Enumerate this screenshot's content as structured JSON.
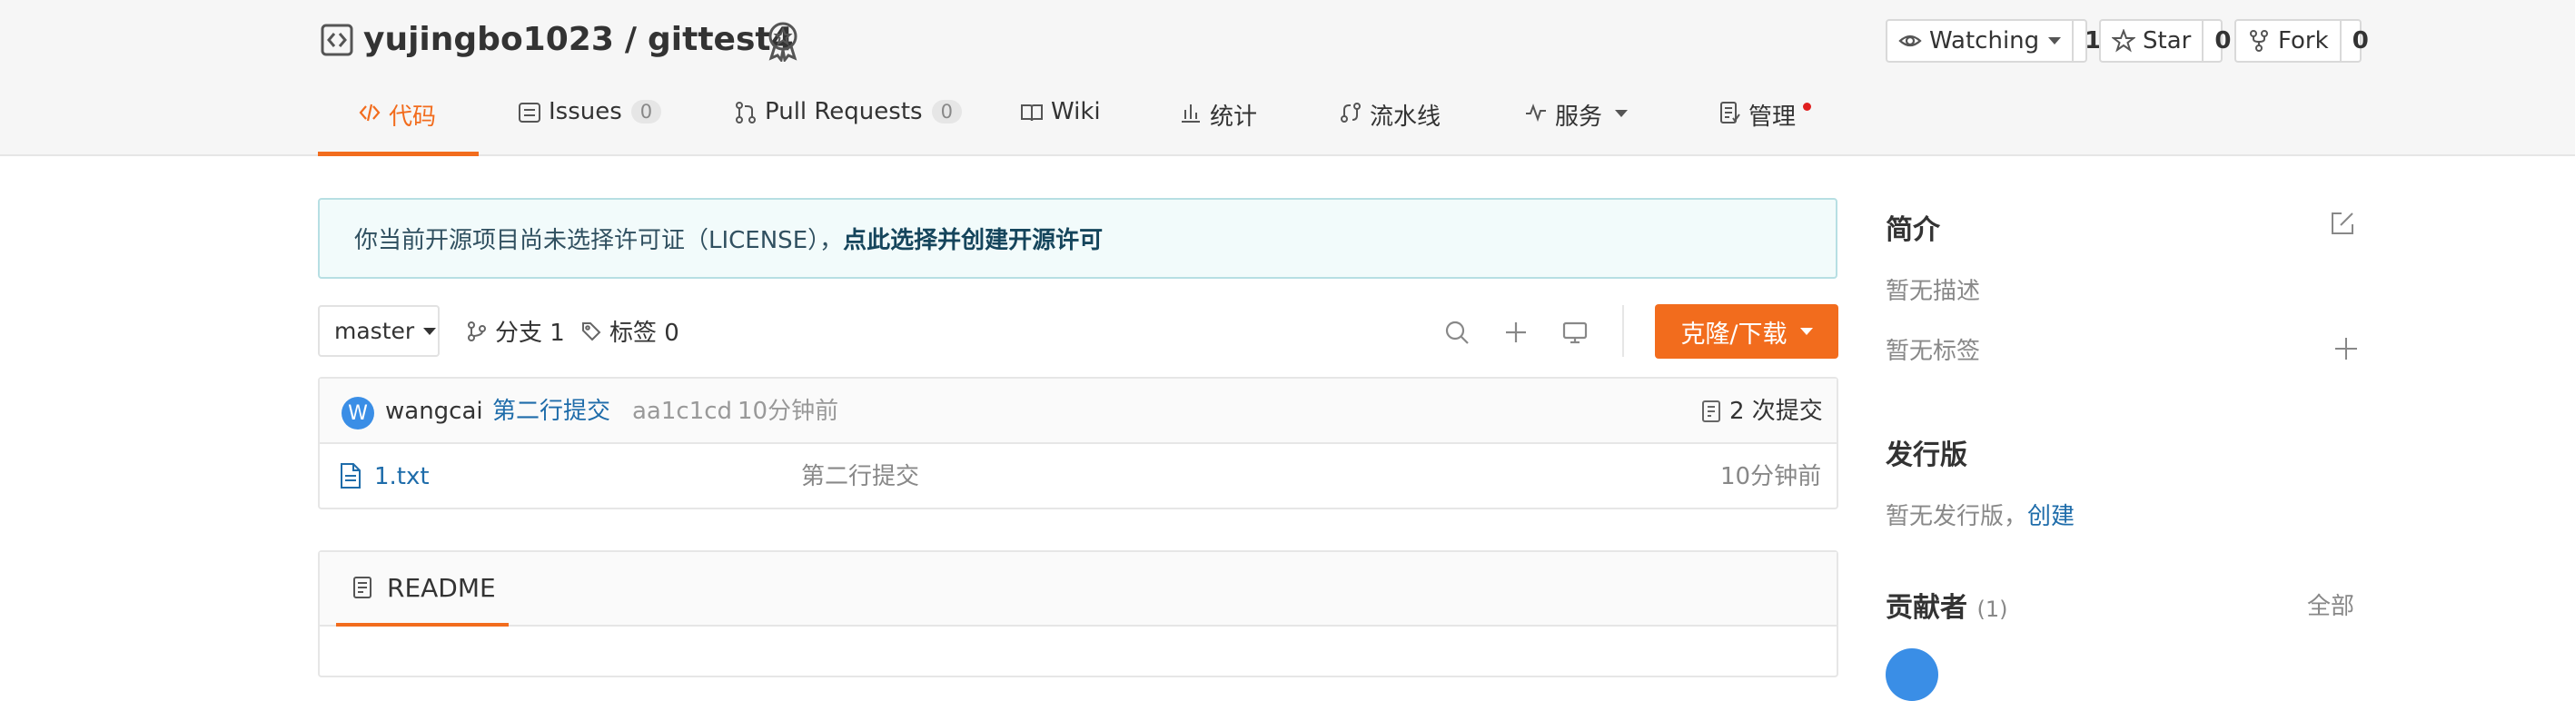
{
  "header": {
    "owner": "yujingbo1023",
    "separator": "/",
    "repo": "gittest4",
    "watch": {
      "label": "Watching",
      "count": "1"
    },
    "star": {
      "label": "Star",
      "count": "0"
    },
    "fork": {
      "label": "Fork",
      "count": "0"
    }
  },
  "tabs": [
    {
      "label": "代码",
      "active": true
    },
    {
      "label": "Issues",
      "badge": "0"
    },
    {
      "label": "Pull Requests",
      "badge": "0"
    },
    {
      "label": "Wiki"
    },
    {
      "label": "统计"
    },
    {
      "label": "流水线"
    },
    {
      "label": "服务"
    },
    {
      "label": "管理"
    }
  ],
  "notice": {
    "text": "你当前开源项目尚未选择许可证（LICENSE），",
    "link": "点此选择并创建开源许可"
  },
  "branch_bar": {
    "branch": "master",
    "branches": "分支 1",
    "tags": "标签 0",
    "clone_label": "克隆/下载"
  },
  "latest_commit": {
    "avatar_letter": "W",
    "author": "wangcai",
    "message": "第二行提交",
    "hash": "aa1c1cd",
    "time": "10分钟前",
    "commit_count": "2 次提交"
  },
  "files": [
    {
      "name": "1.txt",
      "message": "第二行提交",
      "time": "10分钟前"
    }
  ],
  "readme": {
    "title": "README"
  },
  "sidebar": {
    "intro_title": "简介",
    "no_desc": "暂无描述",
    "no_tags": "暂无标签",
    "release_title": "发行版",
    "no_release": "暂无发行版，",
    "create_link": "创建",
    "contrib_title": "贡献者",
    "contrib_count": "(1)",
    "all_link": "全部"
  },
  "colors": {
    "accent": "#f26c1d",
    "link": "#1e6caa",
    "avatar": "#3a8ee6",
    "notice_bg": "#f2fbfb"
  }
}
